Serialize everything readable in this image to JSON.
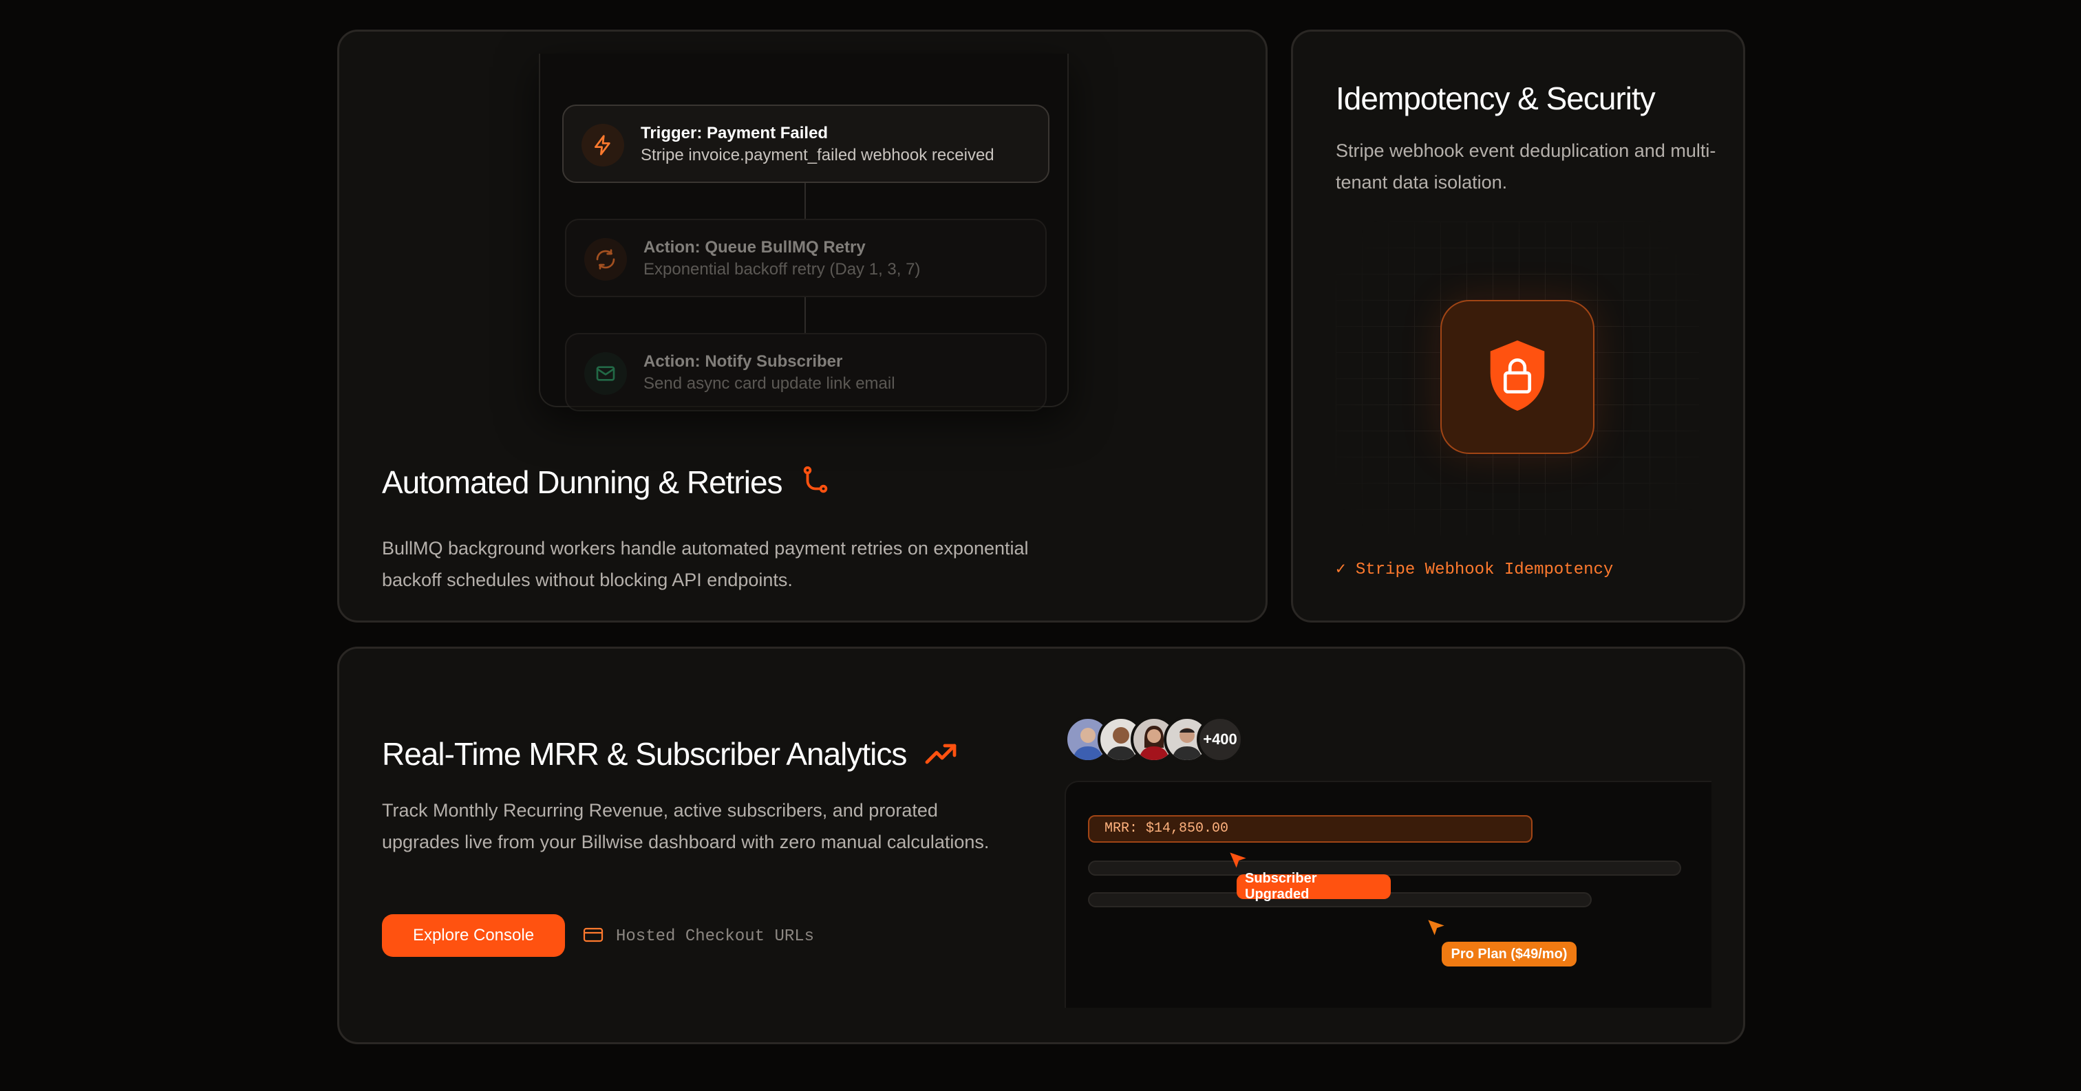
{
  "dunning": {
    "steps": [
      {
        "title": "Trigger: Payment Failed",
        "subtitle": "Stripe invoice.payment_failed webhook received",
        "icon": "lightning-icon"
      },
      {
        "title": "Action: Queue BullMQ Retry",
        "subtitle": "Exponential backoff retry (Day 1, 3, 7)",
        "icon": "refresh-icon"
      },
      {
        "title": "Action: Notify Subscriber",
        "subtitle": "Send async card update link email",
        "icon": "mail-icon"
      }
    ],
    "title": "Automated Dunning & Retries",
    "description": "BullMQ background workers handle automated payment retries on exponential backoff schedules without blocking API endpoints."
  },
  "security": {
    "title": "Idempotency & Security",
    "description": "Stripe webhook event deduplication and multi-tenant data isolation.",
    "check_label": "✓ Stripe Webhook Idempotency"
  },
  "analytics": {
    "title": "Real-Time MRR & Subscriber Analytics",
    "description": "Track Monthly Recurring Revenue, active subscribers, and prorated upgrades live from your Billwise dashboard with zero manual calculations.",
    "cta_label": "Explore Console",
    "checkout_label": "Hosted Checkout URLs",
    "avatar_more": "+400",
    "mrr_label": "MRR: $14,850.00",
    "event_upgraded": "Subscriber Upgraded",
    "event_plan": "Pro Plan ($49/mo)"
  },
  "colors": {
    "accent": "#ff5210",
    "accent_soft": "#ff7a2e",
    "plan_pill": "#f07a12",
    "success": "#2fa36b"
  }
}
